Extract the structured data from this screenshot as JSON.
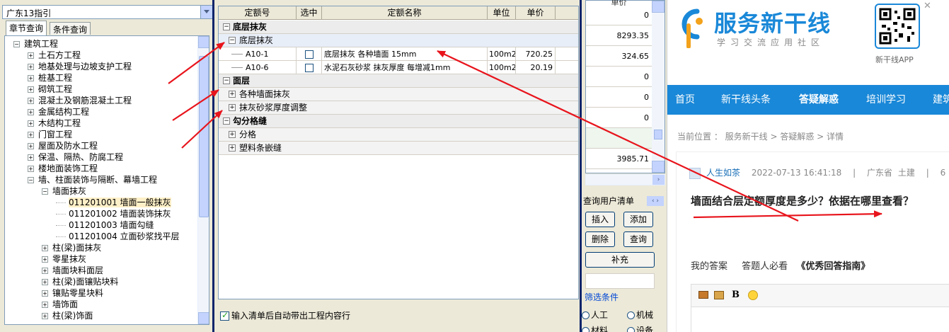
{
  "left_panel": {
    "combo_value": "广东13指引",
    "tabs": [
      "章节查询",
      "条件查询"
    ],
    "tree": [
      {
        "label": "建筑工程",
        "level": 0,
        "sign": "−"
      },
      {
        "label": "土石方工程",
        "level": 1,
        "sign": "+"
      },
      {
        "label": "地基处理与边坡支护工程",
        "level": 1,
        "sign": "+"
      },
      {
        "label": "桩基工程",
        "level": 1,
        "sign": "+"
      },
      {
        "label": "砌筑工程",
        "level": 1,
        "sign": "+"
      },
      {
        "label": "混凝土及钢筋混凝土工程",
        "level": 1,
        "sign": "+"
      },
      {
        "label": "金属结构工程",
        "level": 1,
        "sign": "+"
      },
      {
        "label": "木结构工程",
        "level": 1,
        "sign": "+"
      },
      {
        "label": "门窗工程",
        "level": 1,
        "sign": "+"
      },
      {
        "label": "屋面及防水工程",
        "level": 1,
        "sign": "+"
      },
      {
        "label": "保温、隔热、防腐工程",
        "level": 1,
        "sign": "+"
      },
      {
        "label": "楼地面装饰工程",
        "level": 1,
        "sign": "+"
      },
      {
        "label": "墙、柱面装饰与隔断、幕墙工程",
        "level": 1,
        "sign": "−"
      },
      {
        "label": "墙面抹灰",
        "level": 2,
        "sign": "−"
      },
      {
        "label": "011201001   墙面一般抹灰",
        "level": 3,
        "sign": "",
        "selected": true
      },
      {
        "label": "011201002   墙面装饰抹灰",
        "level": 3,
        "sign": ""
      },
      {
        "label": "011201003   墙面勾缝",
        "level": 3,
        "sign": ""
      },
      {
        "label": "011201004   立面砂浆找平层",
        "level": 3,
        "sign": ""
      },
      {
        "label": "柱(梁)面抹灰",
        "level": 2,
        "sign": "+"
      },
      {
        "label": "零星抹灰",
        "level": 2,
        "sign": "+"
      },
      {
        "label": "墙面块料面层",
        "level": 2,
        "sign": "+"
      },
      {
        "label": "柱(梁)面镶贴块料",
        "level": 2,
        "sign": "+"
      },
      {
        "label": "镶贴零星块料",
        "level": 2,
        "sign": "+"
      },
      {
        "label": "墙饰面",
        "level": 2,
        "sign": "+"
      },
      {
        "label": "柱(梁)饰面",
        "level": 2,
        "sign": "+"
      }
    ]
  },
  "grid": {
    "headers": [
      "定额号",
      "选中",
      "定额名称",
      "单位",
      "单价"
    ],
    "rows": [
      {
        "kind": "g1",
        "sign": "−",
        "label": "底层抹灰"
      },
      {
        "kind": "g2",
        "sign": "−",
        "label": "底层抹灰",
        "highlight": true
      },
      {
        "kind": "d",
        "code": "A10-1",
        "name": "底层抹灰 各种墙面 15mm",
        "unit": "100m2",
        "price": "720.25"
      },
      {
        "kind": "d",
        "code": "A10-6",
        "name": "水泥石灰砂浆 抹灰厚度 每增减1mm",
        "unit": "100m2",
        "price": "20.19"
      },
      {
        "kind": "g1",
        "sign": "−",
        "label": "面层"
      },
      {
        "kind": "g2",
        "sign": "+",
        "label": "各种墙面抹灰"
      },
      {
        "kind": "g2",
        "sign": "+",
        "label": "抹灰砂浆厚度调整"
      },
      {
        "kind": "g1",
        "sign": "−",
        "label": "勾分格缝"
      },
      {
        "kind": "g2",
        "sign": "+",
        "label": "分格"
      },
      {
        "kind": "g2",
        "sign": "+",
        "label": "塑料条嵌缝"
      }
    ],
    "bottom_checkbox": "输入清单后自动带出工程内容行"
  },
  "right_table": {
    "header": "单价",
    "values": [
      "0",
      "8293.35",
      "324.65",
      "0",
      "0",
      "0",
      "",
      "3985.71"
    ],
    "label": "查询用户清单",
    "buttons": [
      "插入",
      "添加",
      "删除",
      "查询",
      "补充"
    ],
    "filter_label": "筛选条件",
    "radios": [
      "人工",
      "机械",
      "材料",
      "设备"
    ]
  },
  "web": {
    "logo_title": "服务新干线",
    "logo_subtitle": "学习交流应用社区",
    "app_label": "新干线APP",
    "nav": [
      "首页",
      "新干线头条",
      "答疑解惑",
      "培训学习",
      "建筑"
    ],
    "breadcrumb": "当前位置 ： 服务新干线 > 答疑解惑 > 详情",
    "user": "人生如茶",
    "datetime": "2022-07-13 16:41:18",
    "region": "广东省",
    "category": "土建",
    "meta_tail": "6",
    "question": "墙面结合层定额厚度是多少？依据在哪里查看？",
    "my_answer": "我的答案",
    "must_read": "答题人必看",
    "guide": "《优秀回答指南》",
    "bold_btn": "B"
  },
  "colors": {
    "nav_blue": "#1a88d8",
    "arrow_red": "#e8141c",
    "dialog_border": "#0a246a"
  }
}
